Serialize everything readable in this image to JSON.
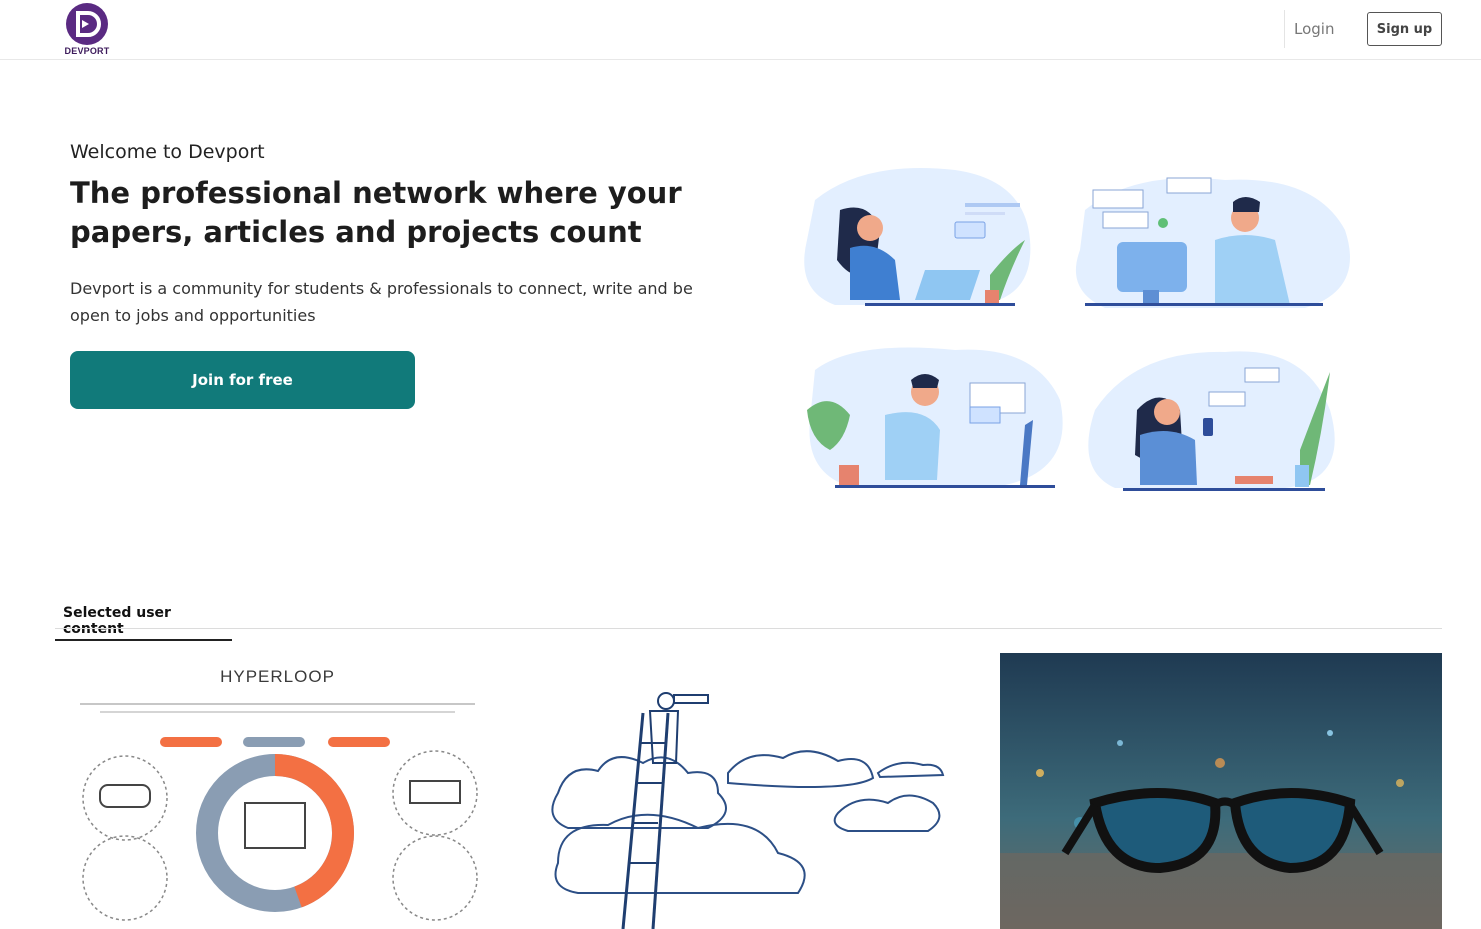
{
  "header": {
    "logo_text": "DEVPORT",
    "login_label": "Login",
    "signup_label": "Sign up"
  },
  "hero": {
    "welcome": "Welcome to Devport",
    "headline": "The professional network where your papers, articles and projects count",
    "description": "Devport is a community for students & professionals to connect, write and be open to jobs and opportunities",
    "join_label": "Join for free"
  },
  "content": {
    "section_label": "Selected user content",
    "cards": [
      {
        "title": "HYPERLOOP"
      }
    ]
  },
  "colors": {
    "brand": "#5a2a82",
    "primary": "#117a7a"
  }
}
